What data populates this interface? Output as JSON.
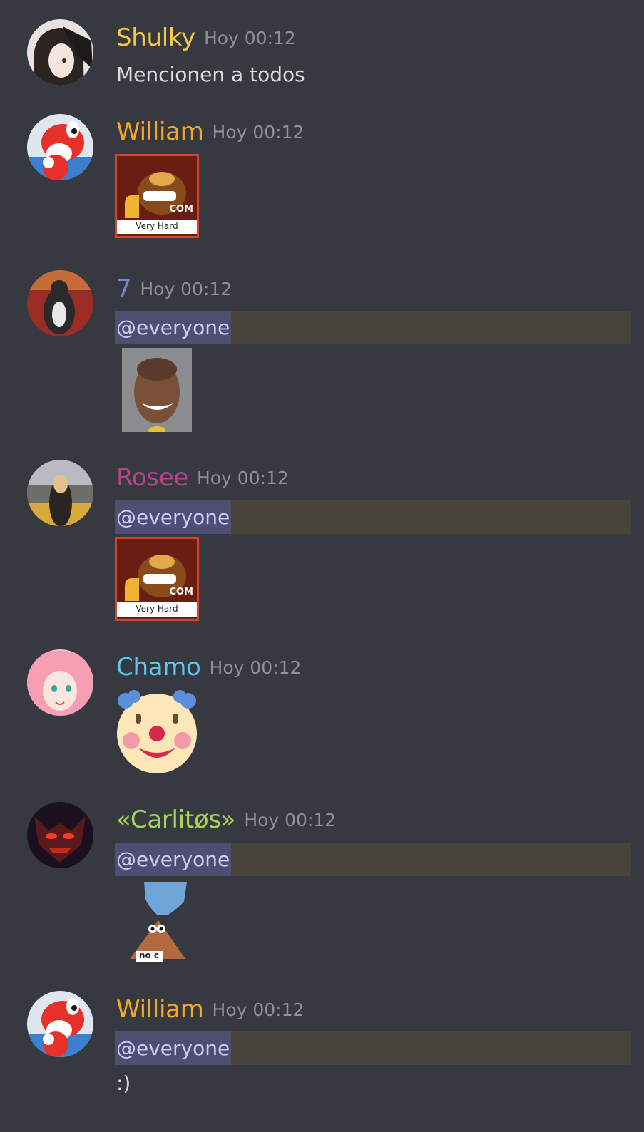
{
  "messages": [
    {
      "author": "Shulky",
      "author_color": "#f0c94a",
      "time": "Hoy 00:12",
      "text": "Mencionen a todos",
      "avatar": "anime-girl-avatar"
    },
    {
      "author": "William",
      "author_color": "#f5a623",
      "time": "Hoy 00:12",
      "attachment": "donkey-kong-very-hard-image",
      "attachment_caption": "Very Hard",
      "attachment_badge": "COM",
      "avatar": "yoshi-avatar"
    },
    {
      "author": "7",
      "author_color": "#7289da",
      "time": "Hoy 00:12",
      "mention": "@everyone",
      "attachment": "smiling-man-photo",
      "avatar": "cat-avatar"
    },
    {
      "author": "Rosee",
      "author_color": "#b8438b",
      "time": "Hoy 00:12",
      "mention": "@everyone",
      "attachment": "donkey-kong-very-hard-image",
      "attachment_caption": "Very Hard",
      "attachment_badge": "COM",
      "avatar": "woman-city-avatar"
    },
    {
      "author": "Chamo",
      "author_color": "#5ec9ee",
      "time": "Hoy 00:12",
      "emoji": "clown-face-emoji",
      "avatar": "pink-hair-anime-avatar"
    },
    {
      "author": "«Carlitøs»",
      "author_color": "#a6d45a",
      "time": "Hoy 00:12",
      "mention": "@everyone",
      "attachment": "patrick-no-c-sticker",
      "attachment_caption": "no c",
      "avatar": "red-demon-avatar"
    },
    {
      "author": "William",
      "author_color": "#f5a623",
      "time": "Hoy 00:12",
      "mention": "@everyone",
      "text": ":)",
      "avatar": "yoshi-avatar"
    }
  ]
}
